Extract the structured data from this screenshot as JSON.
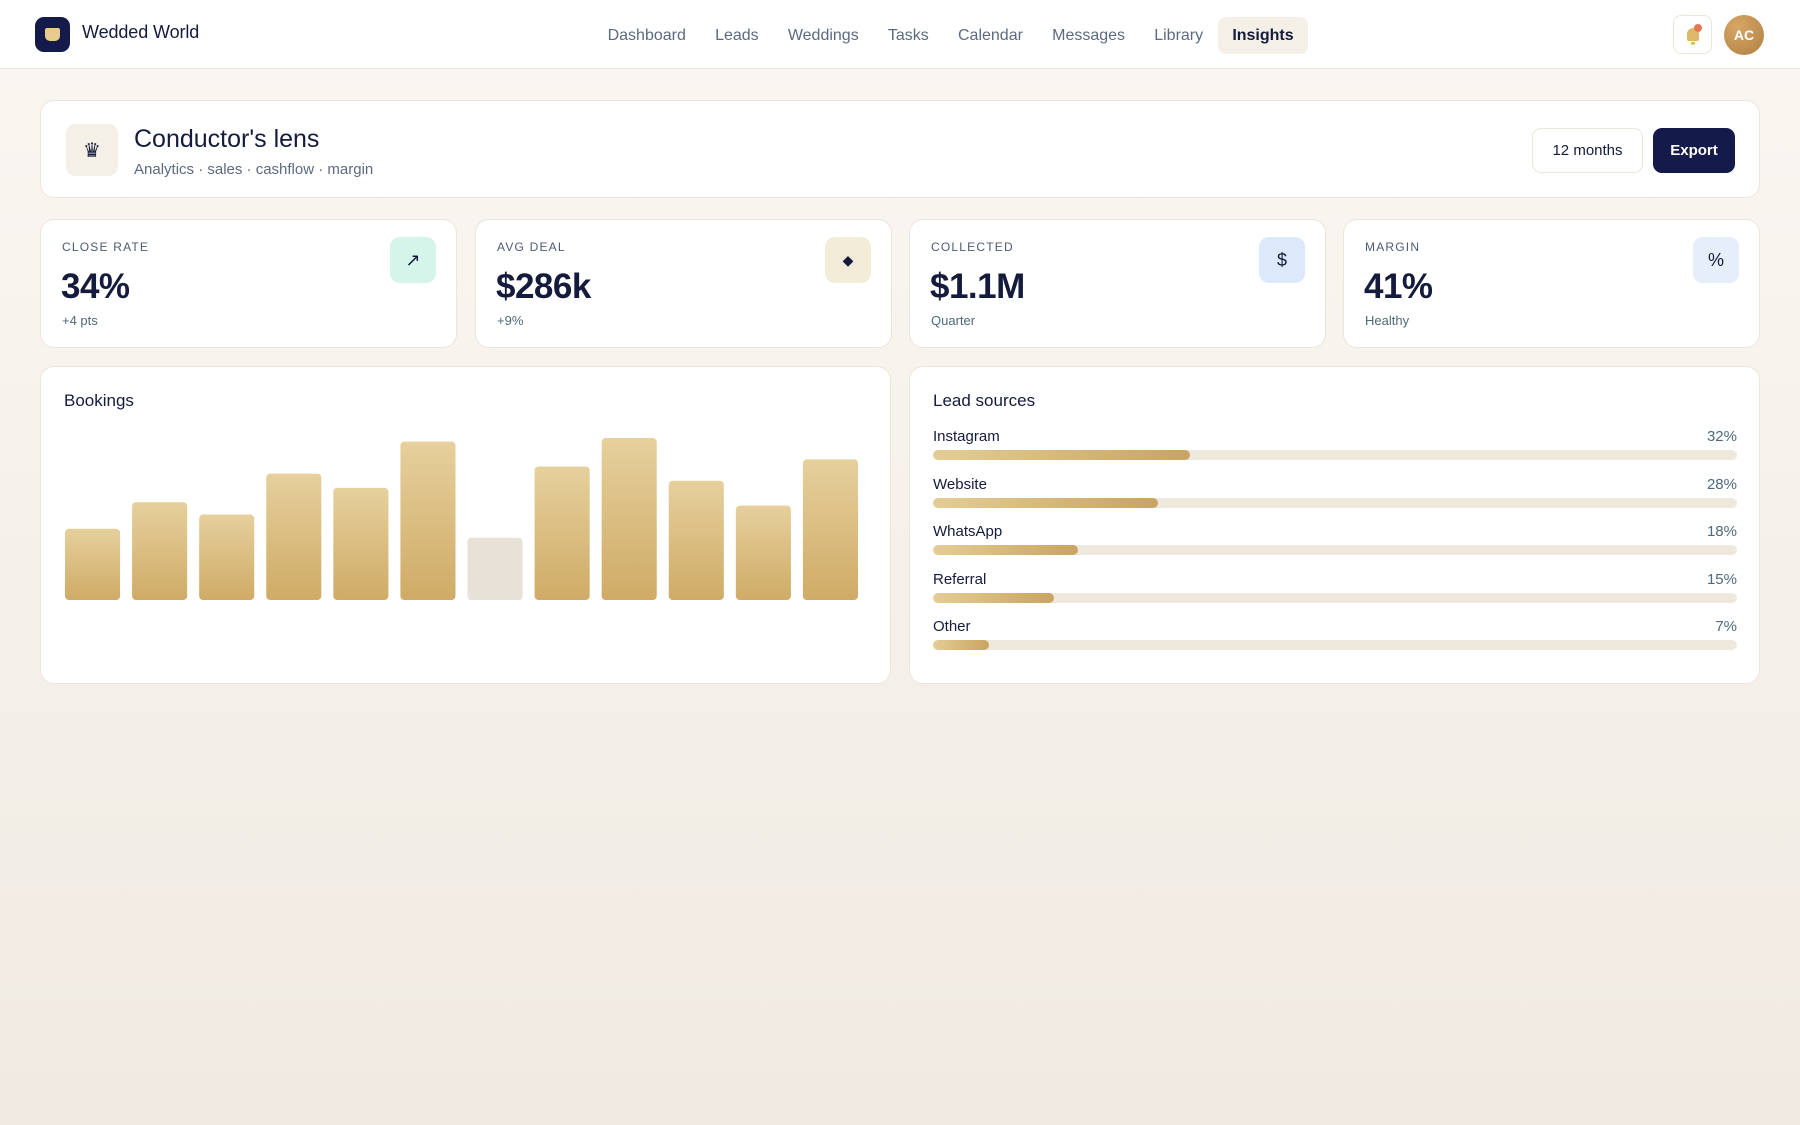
{
  "app": {
    "name": "Wedded World"
  },
  "nav": [
    {
      "label": "Dashboard",
      "active": false
    },
    {
      "label": "Leads",
      "active": false
    },
    {
      "label": "Weddings",
      "active": false
    },
    {
      "label": "Tasks",
      "active": false
    },
    {
      "label": "Calendar",
      "active": false
    },
    {
      "label": "Messages",
      "active": false
    },
    {
      "label": "Library",
      "active": false
    },
    {
      "label": "Insights",
      "active": true
    }
  ],
  "user": {
    "initials": "AC"
  },
  "header": {
    "icon": "crown-icon",
    "title": "Conductor's lens",
    "subtitle": "Analytics · sales · cashflow · margin",
    "range_label": "12 months",
    "export_label": "Export"
  },
  "kpis": [
    {
      "label": "CLOSE RATE",
      "value": "34%",
      "sub": "+4 pts",
      "icon": "trend-up-icon",
      "glyph": "↗",
      "icon_bg": "#d5f4ea"
    },
    {
      "label": "AVG DEAL",
      "value": "$286k",
      "sub": "+9%",
      "icon": "diamond-icon",
      "glyph": "◆",
      "icon_bg": "#f3ecd9"
    },
    {
      "label": "COLLECTED",
      "value": "$1.1M",
      "sub": "Quarter",
      "icon": "dollar-icon",
      "glyph": "$",
      "icon_bg": "#dbe9fb"
    },
    {
      "label": "MARGIN",
      "value": "41%",
      "sub": "Healthy",
      "icon": "percent-icon",
      "glyph": "%",
      "icon_bg": "#e6eef9"
    }
  ],
  "bookings": {
    "title": "Bookings",
    "chart_data": {
      "type": "bar",
      "values": [
        40,
        55,
        48,
        71,
        63,
        89,
        35,
        75,
        91,
        67,
        53,
        79
      ],
      "muted_index": 6,
      "ylim": [
        0,
        100
      ],
      "colors": {
        "bar": "#cfab66",
        "bar_top": "#e6d09d",
        "muted": "#e7e1d7"
      }
    }
  },
  "lead_sources": {
    "title": "Lead sources",
    "items": [
      {
        "name": "Instagram",
        "pct_label": "32%",
        "value": 32
      },
      {
        "name": "Website",
        "pct_label": "28%",
        "value": 28
      },
      {
        "name": "WhatsApp",
        "pct_label": "18%",
        "value": 18
      },
      {
        "name": "Referral",
        "pct_label": "15%",
        "value": 15
      },
      {
        "name": "Other",
        "pct_label": "7%",
        "value": 7
      }
    ]
  }
}
